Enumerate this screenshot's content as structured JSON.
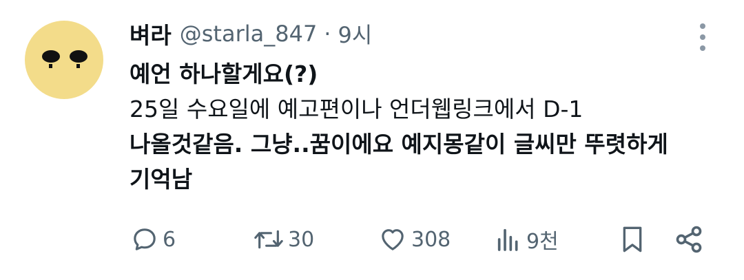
{
  "tweet": {
    "display_name": "벼라",
    "handle": "@starla_847",
    "separator": "·",
    "time": "9시",
    "body_lines": [
      "예언 하나할게요(?)",
      "25일 수요일에 예고편이나 언더웹링크에서 D-1",
      "나올것같음. 그냥..꿈이에요 예지몽같이 글씨만 뚜렷하게",
      "기억남"
    ]
  },
  "actions": {
    "reply": {
      "icon": "reply-icon",
      "count": "6"
    },
    "retweet": {
      "icon": "retweet-icon",
      "count": "30"
    },
    "like": {
      "icon": "heart-icon",
      "count": "308"
    },
    "views": {
      "icon": "views-icon",
      "count": "9천"
    },
    "bookmark": {
      "icon": "bookmark-icon"
    },
    "share": {
      "icon": "share-icon"
    }
  },
  "colors": {
    "avatar_bg": "#f3dc8a",
    "text_primary": "#0f1419",
    "text_secondary": "#536471"
  }
}
